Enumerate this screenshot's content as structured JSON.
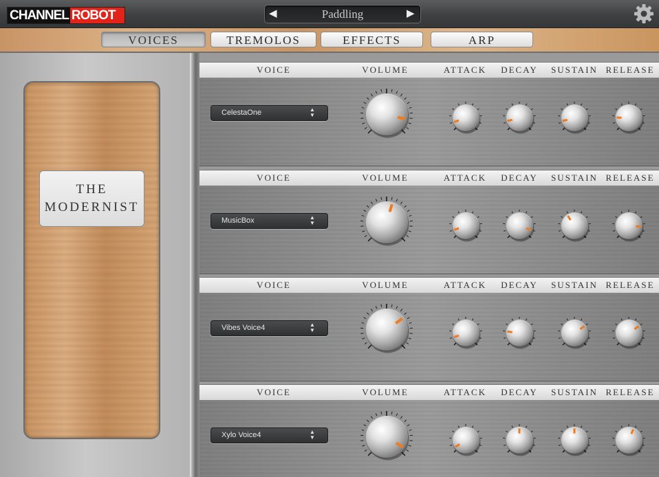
{
  "app": {
    "logo_channel": "CHANNEL",
    "logo_robot": "ROBOT"
  },
  "preset": {
    "name": "Paddling",
    "prev_icon": "◀",
    "next_icon": "▶"
  },
  "settings_icon": "gear-icon",
  "tabs": [
    {
      "label": "VOICES",
      "active": true
    },
    {
      "label": "TREMOLOS",
      "active": false
    },
    {
      "label": "EFFECTS",
      "active": false
    },
    {
      "label": "ARP",
      "active": false
    }
  ],
  "instrument": {
    "line1": "THE",
    "line2": "MODERNIST"
  },
  "headers": {
    "voice": "VOICE",
    "volume": "VOLUME",
    "attack": "ATTACK",
    "decay": "DECAY",
    "sustain": "SUSTAIN",
    "release": "RELEASE"
  },
  "rows": [
    {
      "voice": "CelestaOne",
      "volume": 0.88,
      "attack": 0.1,
      "decay": 0.12,
      "sustain": 0.12,
      "release": 0.18
    },
    {
      "voice": "MusicBox",
      "volume": 0.56,
      "attack": 0.1,
      "decay": 0.9,
      "sustain": 0.38,
      "release": 0.84
    },
    {
      "voice": "Vibes Voice4",
      "volume": 0.7,
      "attack": 0.1,
      "decay": 0.2,
      "sustain": 0.7,
      "release": 0.7
    },
    {
      "voice": "Xylo Voice4",
      "volume": 0.95,
      "attack": 0.05,
      "decay": 0.5,
      "sustain": 0.5,
      "release": 0.58
    }
  ],
  "colors": {
    "indicator": "#f07a1e",
    "logo_red": "#e2231a"
  }
}
